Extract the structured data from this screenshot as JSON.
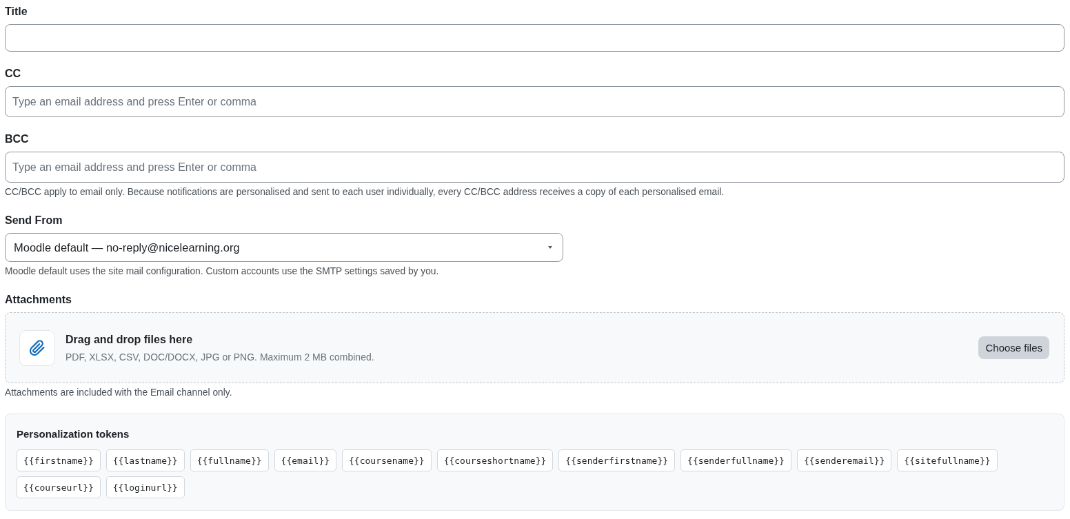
{
  "fields": [
    {
      "kind": "text",
      "label": "Title"
    },
    {
      "kind": "tags",
      "label": "CC",
      "placeholder": "Type an email address and press Enter or comma"
    },
    {
      "kind": "tags",
      "label": "BCC",
      "placeholder": "Type an email address and press Enter or comma",
      "help": "CC/BCC apply to email only. Because notifications are personalised and sent to each user individually, every CC/BCC address receives a copy of each personalised email."
    },
    {
      "kind": "select",
      "label": "Send From",
      "value": "Moodle default — no-reply@nicelearning.org",
      "help": "Moodle default uses the site mail configuration. Custom accounts use the SMTP settings saved by you."
    },
    {
      "kind": "dropzone",
      "label": "Attachments",
      "title": "Drag and drop files here",
      "hint": "PDF, XLSX, CSV, DOC/DOCX, JPG or PNG. Maximum 2 MB combined.",
      "button": "Choose files",
      "help": "Attachments are included with the Email channel only."
    }
  ],
  "tokens_panel": {
    "title": "Personalization tokens",
    "tokens": [
      "{{firstname}}",
      "{{lastname}}",
      "{{fullname}}",
      "{{email}}",
      "{{coursename}}",
      "{{courseshortname}}",
      "{{senderfirstname}}",
      "{{senderfullname}}",
      "{{senderemail}}",
      "{{sitefullname}}",
      "{{courseurl}}",
      "{{loginurl}}"
    ]
  }
}
